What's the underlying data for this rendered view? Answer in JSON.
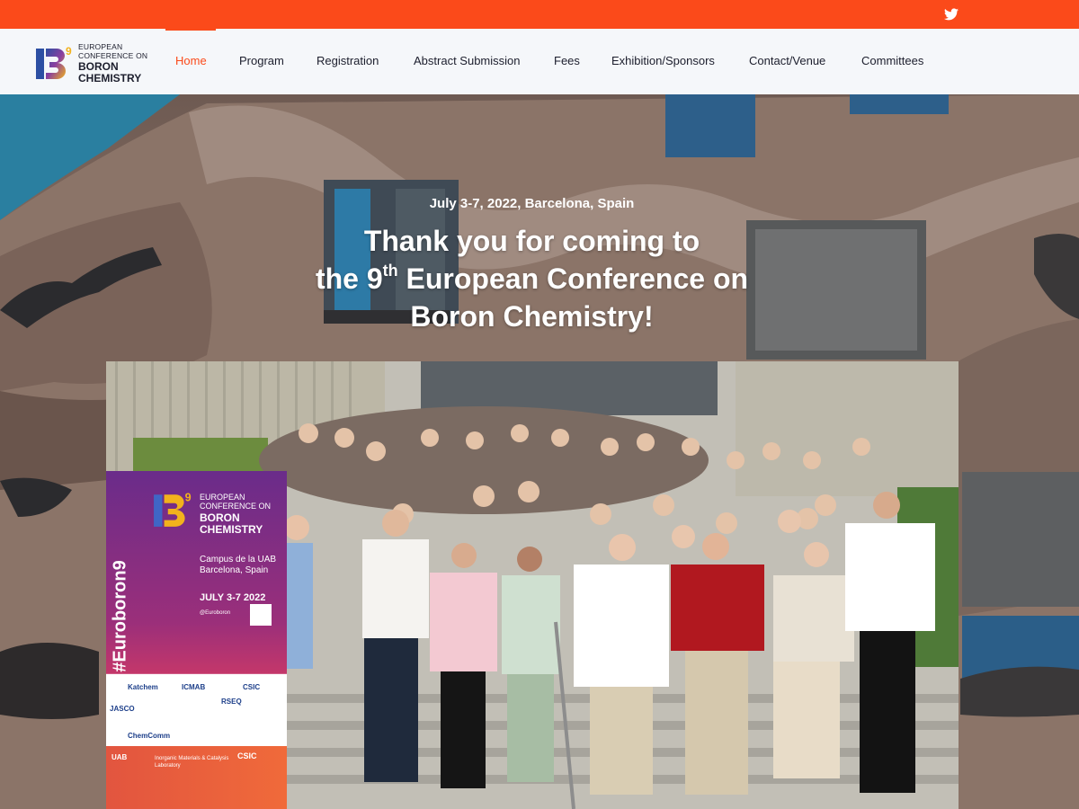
{
  "topbar": {
    "color": "#fb4a1a",
    "social_icon": "twitter-icon"
  },
  "logo": {
    "icon": "b9-logo-icon",
    "line1": "EUROPEAN",
    "line2": "CONFERENCE ON",
    "line3": "BORON",
    "line4": "CHEMISTRY"
  },
  "nav": {
    "items": [
      {
        "label": "Home",
        "active": true
      },
      {
        "label": "Program"
      },
      {
        "label": "Registration"
      },
      {
        "label": "Abstract Submission"
      },
      {
        "label": "Fees"
      },
      {
        "label": "Exhibition/Sponsors"
      },
      {
        "label": "Contact/Venue"
      },
      {
        "label": "Committees"
      }
    ]
  },
  "hero": {
    "subtitle": "July 3-7, 2022, Barcelona, Spain",
    "title_line1": "Thank you for coming to",
    "title_line2_pre": "the 9",
    "title_line2_sup": "th",
    "title_line2_post": " European Conference on",
    "title_line3": "Boron Chemistry!"
  },
  "banner": {
    "hashtag": "#Euroboron9",
    "logo_line1": "EUROPEAN",
    "logo_line2": "CONFERENCE ON",
    "logo_line3": "BORON",
    "logo_line4": "CHEMISTRY",
    "campus_line1": "Campus de la UAB",
    "campus_line2": "Barcelona, Spain",
    "dates": "JULY 3-7 2022",
    "handle": "@Euroboron",
    "sponsors": [
      "Katchem",
      "ICMAB",
      "CSIC",
      "JASCO",
      "RSEQ",
      "ChemComm"
    ],
    "footer_csic": "CSIC",
    "footer_uab": "UAB",
    "footer_lab_line1": "Inorganic Materials & Catalysis",
    "footer_lab_line2": "Laboratory"
  },
  "colors": {
    "accent": "#fb4a1a",
    "text_dark": "#1c1e2d",
    "nav_bg": "#f5f7fa"
  }
}
